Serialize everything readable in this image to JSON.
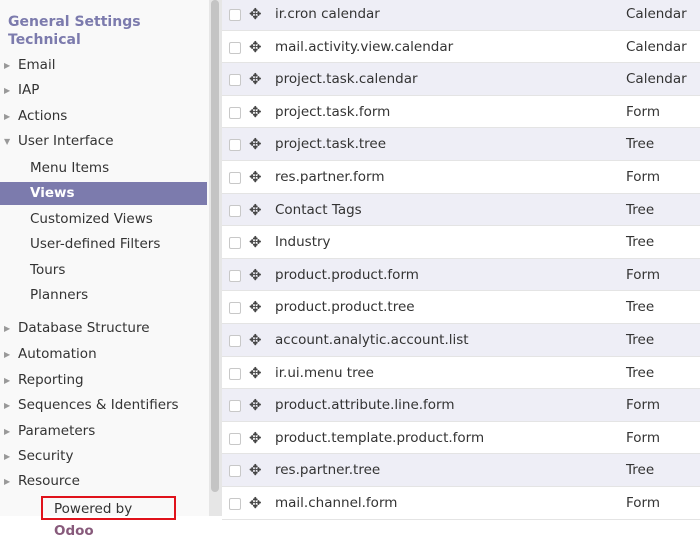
{
  "sidebar": {
    "title1": "General Settings",
    "title2": "Technical",
    "items": [
      {
        "label": "Email",
        "caret": "right"
      },
      {
        "label": "IAP",
        "caret": "right"
      },
      {
        "label": "Actions",
        "caret": "right"
      },
      {
        "label": "User Interface",
        "caret": "down"
      },
      {
        "label": "Menu Items"
      },
      {
        "label": "Views",
        "active": true
      },
      {
        "label": "Customized Views"
      },
      {
        "label": "User-defined Filters"
      },
      {
        "label": "Tours"
      },
      {
        "label": "Planners"
      },
      {
        "label": "Database Structure",
        "caret": "right"
      },
      {
        "label": "Automation",
        "caret": "right"
      },
      {
        "label": "Reporting",
        "caret": "right"
      },
      {
        "label": "Sequences & Identifiers",
        "caret": "right"
      },
      {
        "label": "Parameters",
        "caret": "right"
      },
      {
        "label": "Security",
        "caret": "right"
      },
      {
        "label": "Resource",
        "caret": "right"
      }
    ],
    "powered_prefix": "Powered by",
    "powered_brand": "Odoo"
  },
  "accent": "#7c7bad",
  "rows": [
    {
      "name": "ir.cron calendar",
      "type": "Calendar"
    },
    {
      "name": "mail.activity.view.calendar",
      "type": "Calendar"
    },
    {
      "name": "project.task.calendar",
      "type": "Calendar"
    },
    {
      "name": "project.task.form",
      "type": "Form"
    },
    {
      "name": "project.task.tree",
      "type": "Tree"
    },
    {
      "name": "res.partner.form",
      "type": "Form"
    },
    {
      "name": "Contact Tags",
      "type": "Tree"
    },
    {
      "name": "Industry",
      "type": "Tree"
    },
    {
      "name": "product.product.form",
      "type": "Form"
    },
    {
      "name": "product.product.tree",
      "type": "Tree"
    },
    {
      "name": "account.analytic.account.list",
      "type": "Tree"
    },
    {
      "name": "ir.ui.menu tree",
      "type": "Tree"
    },
    {
      "name": "product.attribute.line.form",
      "type": "Form"
    },
    {
      "name": "product.template.product.form",
      "type": "Form"
    },
    {
      "name": "res.partner.tree",
      "type": "Tree"
    },
    {
      "name": "mail.channel.form",
      "type": "Form"
    }
  ]
}
